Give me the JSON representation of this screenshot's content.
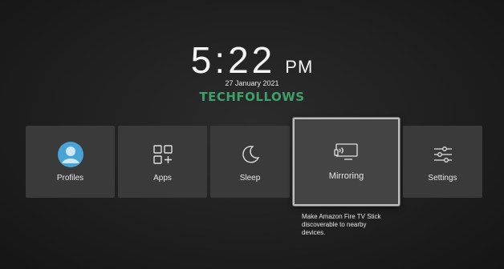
{
  "clock": {
    "time": "5:22",
    "ampm": "PM",
    "date": "27 January 2021"
  },
  "watermark": "TECHFOLLOWS",
  "tiles": [
    {
      "label": "Profiles",
      "icon": "profile-avatar-icon"
    },
    {
      "label": "Apps",
      "icon": "apps-grid-icon"
    },
    {
      "label": "Sleep",
      "icon": "moon-icon"
    },
    {
      "label": "Mirroring",
      "icon": "screen-mirroring-icon",
      "focused": true
    },
    {
      "label": "Settings",
      "icon": "sliders-icon"
    }
  ],
  "tooltip": "Make Amazon Fire TV Stick discoverable to nearby devices.",
  "colors": {
    "accent_avatar": "#4aa3d6",
    "watermark": "#3fa06b",
    "tile_bg": "#3a3a3a"
  }
}
